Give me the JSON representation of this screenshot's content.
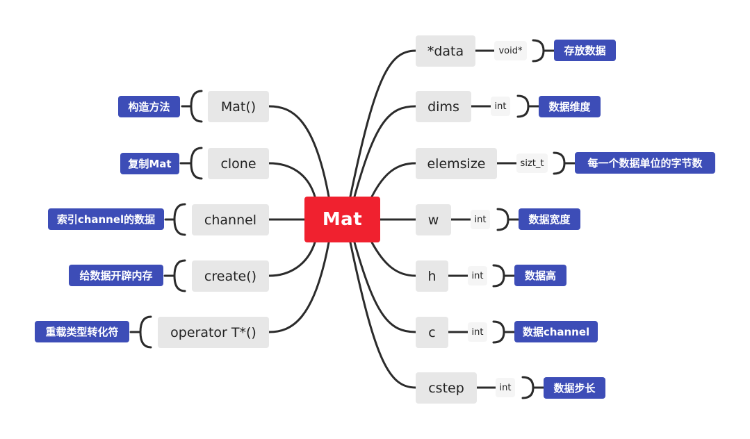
{
  "center": {
    "label": "Mat"
  },
  "left": [
    {
      "label": "Mat()",
      "description": "构造方法"
    },
    {
      "label": "clone",
      "description": "复制Mat"
    },
    {
      "label": "channel",
      "description": "索引channel的数据"
    },
    {
      "label": "create()",
      "description": "给数据开辟内存"
    },
    {
      "label": "operator T*()",
      "description": "重载类型转化符"
    }
  ],
  "right": [
    {
      "label": "*data",
      "type": "void*",
      "description": "存放数据"
    },
    {
      "label": "dims",
      "type": "int",
      "description": "数据维度"
    },
    {
      "label": "elemsize",
      "type": "sizt_t",
      "description": "每一个数据单位的字节数"
    },
    {
      "label": "w",
      "type": "int",
      "description": "数据宽度"
    },
    {
      "label": "h",
      "type": "int",
      "description": "数据高"
    },
    {
      "label": "c",
      "type": "int",
      "description": "数据channel"
    },
    {
      "label": "cstep",
      "type": "int",
      "description": "数据步长"
    }
  ],
  "colors": {
    "center": "#f0212f",
    "topic": "#e7e7e7",
    "description": "#3d4db7",
    "connector": "#2b2b2b"
  }
}
